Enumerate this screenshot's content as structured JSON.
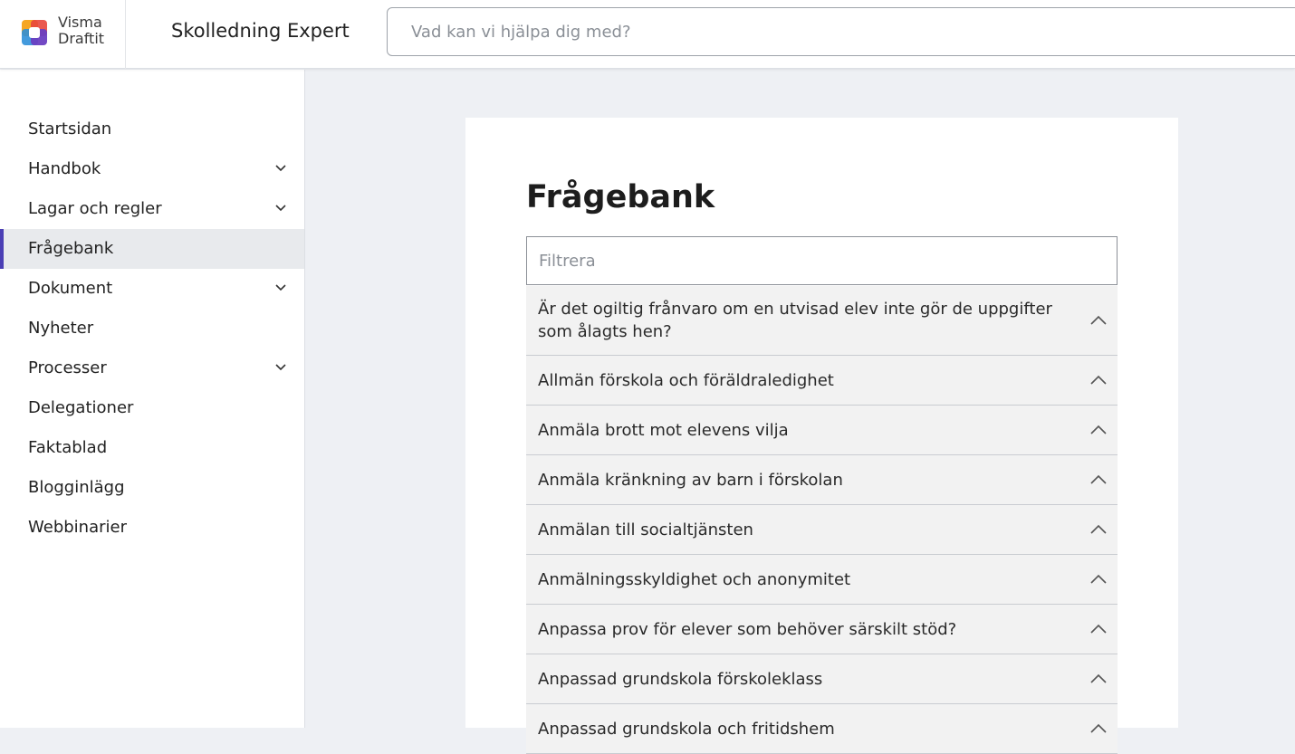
{
  "header": {
    "logo_line1": "Visma",
    "logo_line2": "Draftit",
    "app_title": "Skolledning Expert",
    "search_placeholder": "Vad kan vi hjälpa dig med?"
  },
  "sidebar": {
    "items": [
      {
        "label": "Startsidan",
        "expandable": false
      },
      {
        "label": "Handbok",
        "expandable": true
      },
      {
        "label": "Lagar och regler",
        "expandable": true
      },
      {
        "label": "Frågebank",
        "expandable": false,
        "active": true
      },
      {
        "label": "Dokument",
        "expandable": true
      },
      {
        "label": "Nyheter",
        "expandable": false
      },
      {
        "label": "Processer",
        "expandable": true
      },
      {
        "label": "Delegationer",
        "expandable": false
      },
      {
        "label": "Faktablad",
        "expandable": false
      },
      {
        "label": "Blogginlägg",
        "expandable": false
      },
      {
        "label": "Webbinarier",
        "expandable": false
      }
    ]
  },
  "main": {
    "title": "Frågebank",
    "filter_placeholder": "Filtrera",
    "questions": [
      "Är det ogiltig frånvaro om en utvisad elev inte gör de uppgifter som ålagts hen?",
      "Allmän förskola och föräldraledighet",
      "Anmäla brott mot elevens vilja",
      "Anmäla kränkning av barn i förskolan",
      "Anmälan till socialtjänsten",
      "Anmälningsskyldighet och anonymitet",
      "Anpassa prov för elever som behöver särskilt stöd?",
      "Anpassad grundskola förskoleklass",
      "Anpassad grundskola och fritidshem"
    ]
  },
  "colors": {
    "accent": "#4b3fb5",
    "active_bg": "#e8eaed",
    "page_bg": "#eef0f4"
  }
}
